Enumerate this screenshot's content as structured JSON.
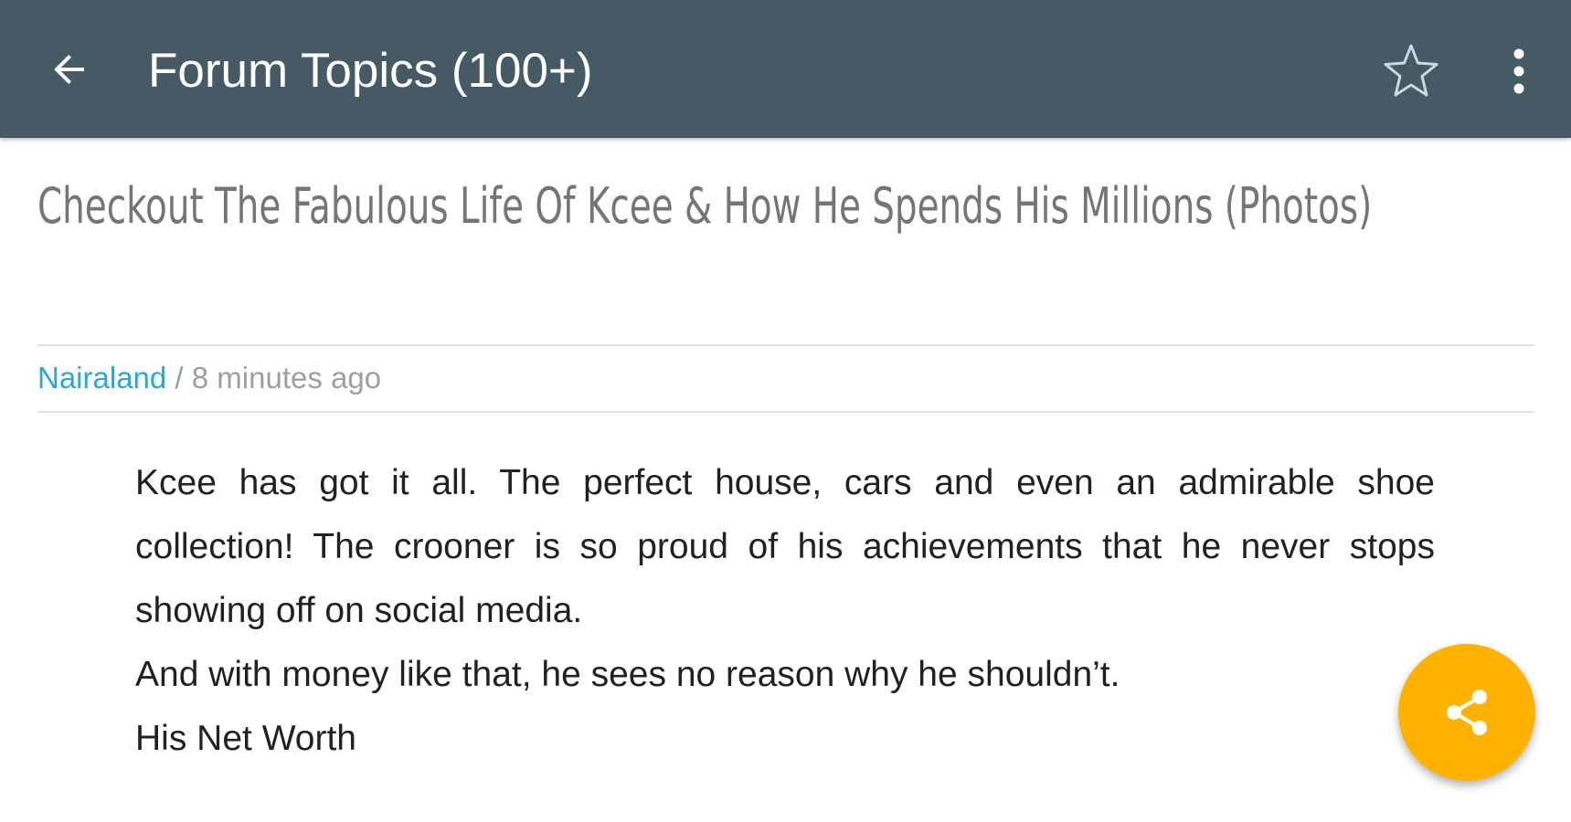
{
  "appbar": {
    "title": "Forum Topics (100+)",
    "back_icon": "arrow-back-icon",
    "star_icon": "star-outline-icon",
    "more_icon": "more-vert-icon",
    "color": "#455a64"
  },
  "article": {
    "title": "Checkout The Fabulous Life Of Kcee & How He Spends His Millions (Photos)",
    "source": "Nairaland",
    "separator": " / ",
    "time_ago": "8 minutes ago",
    "paragraphs": [
      "Kcee has got it all. The perfect house, cars and even an admirable shoe collection! The crooner is so proud of his achievements that he never stops showing off on social media.",
      "And with money like that, he sees no reason why he shouldn’t.",
      "His Net Worth"
    ]
  },
  "fab": {
    "icon": "share-icon",
    "color": "#ffb300"
  },
  "colors": {
    "source_link": "#29a8d6",
    "title_text": "#757575",
    "meta_text": "#9e9e9e"
  }
}
